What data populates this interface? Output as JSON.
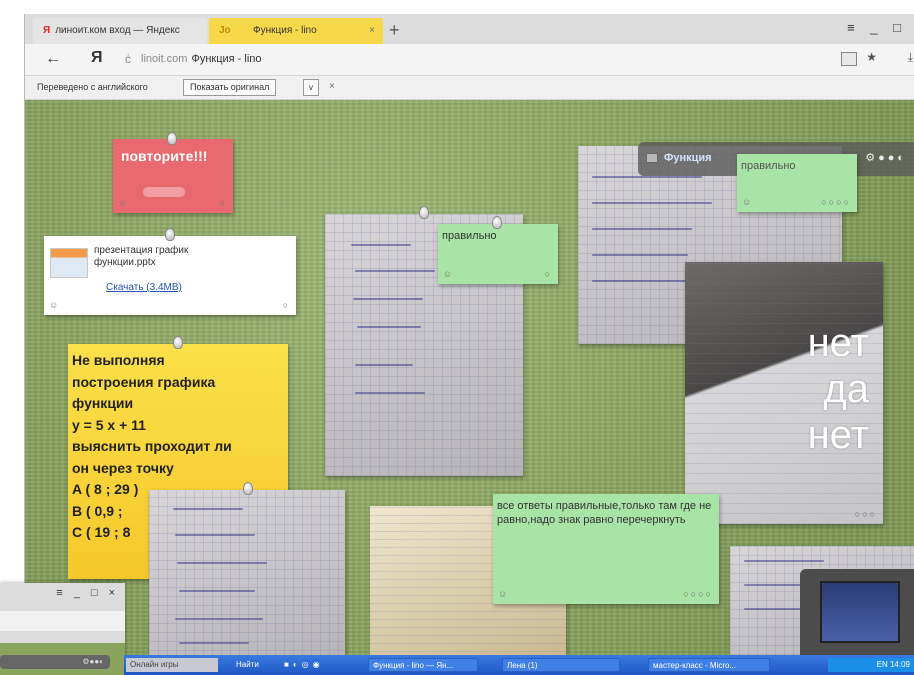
{
  "browser": {
    "tabs": [
      {
        "label": "линоит.ком вход — Яндекс",
        "active": false
      },
      {
        "label": "Функция - lino",
        "active": true
      }
    ],
    "new_tab": "+",
    "window_controls": "≡ _ □",
    "address": {
      "domain": "linoit.com",
      "page_title": "Функция - lino"
    },
    "translate_bar": {
      "text": "Переведено с английского",
      "show_original": "Показать оригинал",
      "dropdown": "v",
      "close": "×"
    }
  },
  "board": {
    "notes": {
      "red": "повторите!!!",
      "file": {
        "name": "презентация график функции.pptx",
        "download": "Скачать (3.4MB)"
      },
      "yellow": "Не выполняя\nпостроения графика\nфункции\ny = 5 x + 11\nвыяснить проходит ли\nон через точку\nA ( 8 ; 29 )\nB ( 0,9 ;\nC ( 19 ; 8",
      "green_center": "правильно",
      "green_topright": "правильно",
      "green_bottom": "все ответы правильные,только там где не равно,надо знак равно перечеркнуть",
      "photo_overlay_lines": [
        "нет",
        "да",
        "нет"
      ]
    },
    "panel_title": "Функция",
    "panel_controls": "⚙●●◐"
  },
  "mini_window": {
    "controls": "≡ _ □ ×",
    "bar_dots": "⚙●●◐"
  },
  "taskbar": {
    "games": "Онлайн игры",
    "find": "Найти",
    "tasks": [
      "Функция - lino — Ян...",
      "Лена (1)",
      "мастер-класс - Micro..."
    ],
    "tray": "EN  14:09"
  },
  "colors": {
    "board_green": "#8aa45d",
    "note_red": "#e86a6f",
    "note_yellow": "#f5c82a",
    "note_green": "#a8e4a6",
    "active_tab": "#f7d84b",
    "taskbar": "#1f57c4"
  }
}
